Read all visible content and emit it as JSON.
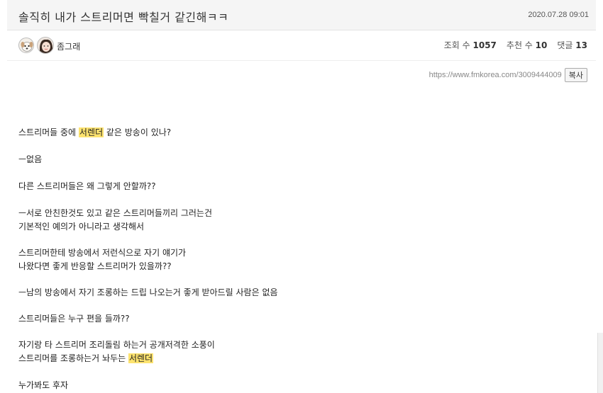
{
  "post": {
    "title": "솔직히 내가 스트리머면 빡칠거 같긴해ㅋㅋ",
    "date": "2020.07.28 09:01"
  },
  "meta": {
    "author": "좀그래",
    "views_label": "조회 수",
    "views": "1057",
    "votes_label": "추천 수",
    "votes": "10",
    "comments_label": "댓글",
    "comments": "13"
  },
  "link": {
    "url": "https://www.fmkorea.com/3009444009",
    "copy_label": "복사"
  },
  "body": {
    "l1a": "스트리머들 중에 ",
    "l1b": "서렌더",
    "l1c": " 같은 방송이 있나?",
    "l2": "ㅡ없음",
    "l3": "다른 스트리머들은 왜 그렇게 안할까??",
    "l4": "ㅡ서로 안친한것도 있고 같은 스트리머들끼리 그러는건",
    "l5": "기본적인 예의가 아니라고 생각해서",
    "l6": "스트리머한테 방송에서 저런식으로 자기 얘기가",
    "l7": "나왔다면 좋게 반응할 스트리머가 있을까??",
    "l8": "ㅡ남의 방송에서 자기 조롱하는 드립 나오는거 좋게 받아드릴 사람은 없음",
    "l9": "스트리머들은 누구 편을 들까??",
    "l10": "자기랑 타 스트리머 조리돌림 하는거 공개저격한 소풍이",
    "l11a": "스트리머를 조롱하는거 놔두는 ",
    "l11b": "서렌더",
    "l12": "누가봐도 후자"
  },
  "colors": {
    "highlight": "#fde36f",
    "header_bg": "#f5f5f5"
  },
  "icons": {
    "level": "dog-level-icon",
    "avatar": "user-avatar"
  }
}
